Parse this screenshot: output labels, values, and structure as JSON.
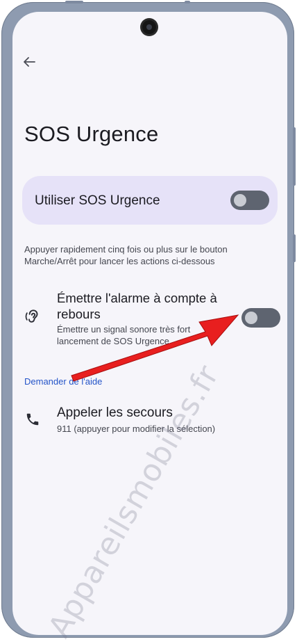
{
  "screen": {
    "title": "SOS Urgence"
  },
  "main_toggle": {
    "label": "Utiliser SOS Urgence",
    "enabled": false
  },
  "description": "Appuyer rapidement cinq fois ou plus sur le bouton Marche/Arrêt pour lancer les actions ci-dessous",
  "alarm": {
    "title": "Émettre l'alarme à compte à rebours",
    "subtitle_line1": "Émettre un signal sonore très fort",
    "subtitle_line2": "lancement de SOS Urgence",
    "enabled": false
  },
  "section_help": {
    "label": "Demander de l'aide"
  },
  "call": {
    "title": "Appeler les secours",
    "subtitle": "911 (appuyer pour modifier la sélection)"
  },
  "watermark": "Appareilsmobiles.fr",
  "colors": {
    "screen_bg": "#f6f5fa",
    "card_bg": "#e6e2f8",
    "toggle_off": "#5e6470",
    "link_blue": "#2454c8",
    "arrow_red": "#e81f1f"
  },
  "icons": {
    "back": "arrow-back-icon",
    "alarm": "hearing-icon",
    "call": "phone-icon"
  }
}
